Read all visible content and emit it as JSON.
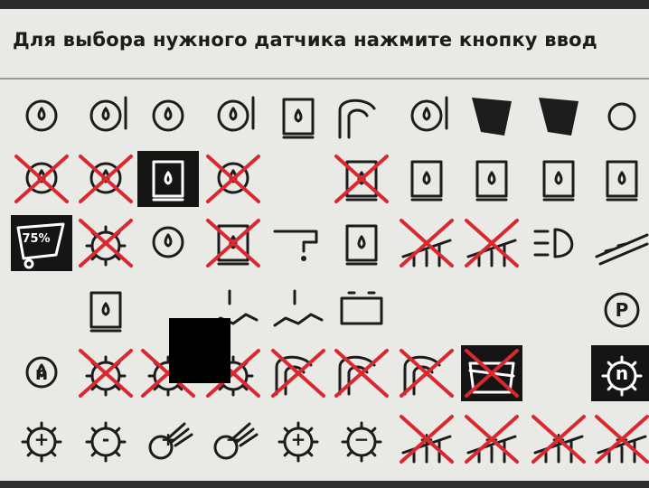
{
  "screen": {
    "title": "Для выбора нужного датчика нажмите кнопку ввод",
    "colors": {
      "background": "#e9e9e6",
      "ink": "#1c1c1c",
      "cross": "#d9282f",
      "selected": "#151515"
    }
  },
  "grid": {
    "rows": [
      {
        "items": [
          {
            "icon": "oil-pressure-icon",
            "selected": false,
            "crossed": false
          },
          {
            "icon": "engine-coolant-temp-icon",
            "selected": false,
            "crossed": false
          },
          {
            "icon": "oil-level-icon",
            "selected": false,
            "crossed": false
          },
          {
            "icon": "oil-temperature-icon",
            "selected": false,
            "crossed": false
          },
          {
            "icon": "fuel-tank-icon",
            "selected": false,
            "crossed": false
          },
          {
            "icon": "spray-icon",
            "selected": false,
            "crossed": false
          },
          {
            "icon": "hydraulic-oil-temp-icon",
            "selected": false,
            "crossed": false
          },
          {
            "icon": "bucket-icon",
            "selected": false,
            "crossed": false
          },
          {
            "icon": "bucket-icon-2",
            "selected": false,
            "crossed": false
          },
          {
            "icon": "brake-fluid-icon",
            "selected": false,
            "crossed": false
          }
        ]
      },
      {
        "items": [
          {
            "icon": "oil-filter-icon",
            "selected": false,
            "crossed": true
          },
          {
            "icon": "coolant-filter-icon",
            "selected": false,
            "crossed": true
          },
          {
            "icon": "hydraulic-filter-icon",
            "selected": true,
            "crossed": false
          },
          {
            "icon": "gear-oil-icon",
            "selected": false,
            "crossed": true
          },
          {
            "icon": "empty-slot",
            "selected": false,
            "crossed": false
          },
          {
            "icon": "fuel-filter-icon",
            "selected": false,
            "crossed": true
          },
          {
            "icon": "fuel-pump-icon",
            "selected": false,
            "crossed": false
          },
          {
            "icon": "fuel-level-icon",
            "selected": false,
            "crossed": false
          },
          {
            "icon": "hydraulic-level-icon",
            "selected": false,
            "crossed": false
          },
          {
            "icon": "hydraulic-level-icon-2",
            "selected": false,
            "crossed": false
          }
        ]
      },
      {
        "items": [
          {
            "icon": "load-percent-icon",
            "label": "75%",
            "selected": true,
            "crossed": false
          },
          {
            "icon": "gear-speed-icon",
            "selected": false,
            "crossed": true
          },
          {
            "icon": "engine-oil-icon",
            "selected": false,
            "crossed": false
          },
          {
            "icon": "air-filter-icon",
            "selected": false,
            "crossed": true
          },
          {
            "icon": "faucet-icon",
            "selected": false,
            "crossed": false
          },
          {
            "icon": "container-level-icon",
            "selected": false,
            "crossed": false
          },
          {
            "icon": "slope-icon",
            "selected": false,
            "crossed": true
          },
          {
            "icon": "slope-icon-2",
            "selected": false,
            "crossed": true
          },
          {
            "icon": "headlight-icon",
            "selected": false,
            "crossed": false
          },
          {
            "icon": "conveyor-icon",
            "selected": false,
            "crossed": false
          }
        ]
      },
      {
        "items": [
          {
            "icon": "empty-slot",
            "selected": false,
            "crossed": false
          },
          {
            "icon": "water-level-icon",
            "selected": false,
            "crossed": false
          },
          {
            "icon": "empty-slot",
            "selected": false,
            "crossed": false
          },
          {
            "icon": "ground-icon",
            "selected": false,
            "crossed": false
          },
          {
            "icon": "rain-icon",
            "selected": false,
            "crossed": false
          },
          {
            "icon": "battery-icon",
            "selected": false,
            "crossed": false
          },
          {
            "icon": "empty-slot",
            "selected": false,
            "crossed": false
          },
          {
            "icon": "empty-slot",
            "selected": false,
            "crossed": false
          },
          {
            "icon": "empty-slot",
            "selected": false,
            "crossed": false
          },
          {
            "icon": "parking-brake-icon",
            "label": "P",
            "selected": false,
            "crossed": false
          }
        ]
      },
      {
        "items": [
          {
            "icon": "engine-speed-icon",
            "label": "n",
            "selected": false,
            "crossed": false
          },
          {
            "icon": "rotor-speed-icon",
            "selected": false,
            "crossed": true
          },
          {
            "icon": "fan-speed-icon",
            "selected": false,
            "crossed": true
          },
          {
            "icon": "wheel-speed-icon",
            "selected": false,
            "crossed": true
          },
          {
            "icon": "cutter-icon",
            "selected": false,
            "crossed": true
          },
          {
            "icon": "spreader-icon",
            "selected": false,
            "crossed": true
          },
          {
            "icon": "spreader-icon-2",
            "selected": false,
            "crossed": true
          },
          {
            "icon": "rollers-icon",
            "selected": true,
            "crossed": true
          },
          {
            "icon": "empty-slot",
            "selected": false,
            "crossed": false
          },
          {
            "icon": "unload-speed-icon",
            "label": "n",
            "selected": true,
            "crossed": false
          }
        ]
      },
      {
        "items": [
          {
            "icon": "gear-plus-icon",
            "label": "+",
            "selected": false,
            "crossed": false
          },
          {
            "icon": "gear-minus-icon",
            "label": "-",
            "selected": false,
            "crossed": false
          },
          {
            "icon": "fan-plus-icon",
            "label": "+",
            "selected": false,
            "crossed": false
          },
          {
            "icon": "fan-minus-icon",
            "label": "−",
            "selected": false,
            "crossed": false
          },
          {
            "icon": "rotor-plus-icon",
            "label": "+",
            "selected": false,
            "crossed": false
          },
          {
            "icon": "rotor-minus-icon",
            "label": "−",
            "selected": false,
            "crossed": false
          },
          {
            "icon": "height-plus-icon",
            "label": "+",
            "selected": false,
            "crossed": true
          },
          {
            "icon": "height-minus-icon",
            "label": "−",
            "selected": false,
            "crossed": true
          },
          {
            "icon": "tilt-plus-icon",
            "label": "+",
            "selected": false,
            "crossed": true
          },
          {
            "icon": "tilt-minus-icon",
            "label": "−",
            "selected": false,
            "crossed": true
          }
        ]
      }
    ]
  }
}
